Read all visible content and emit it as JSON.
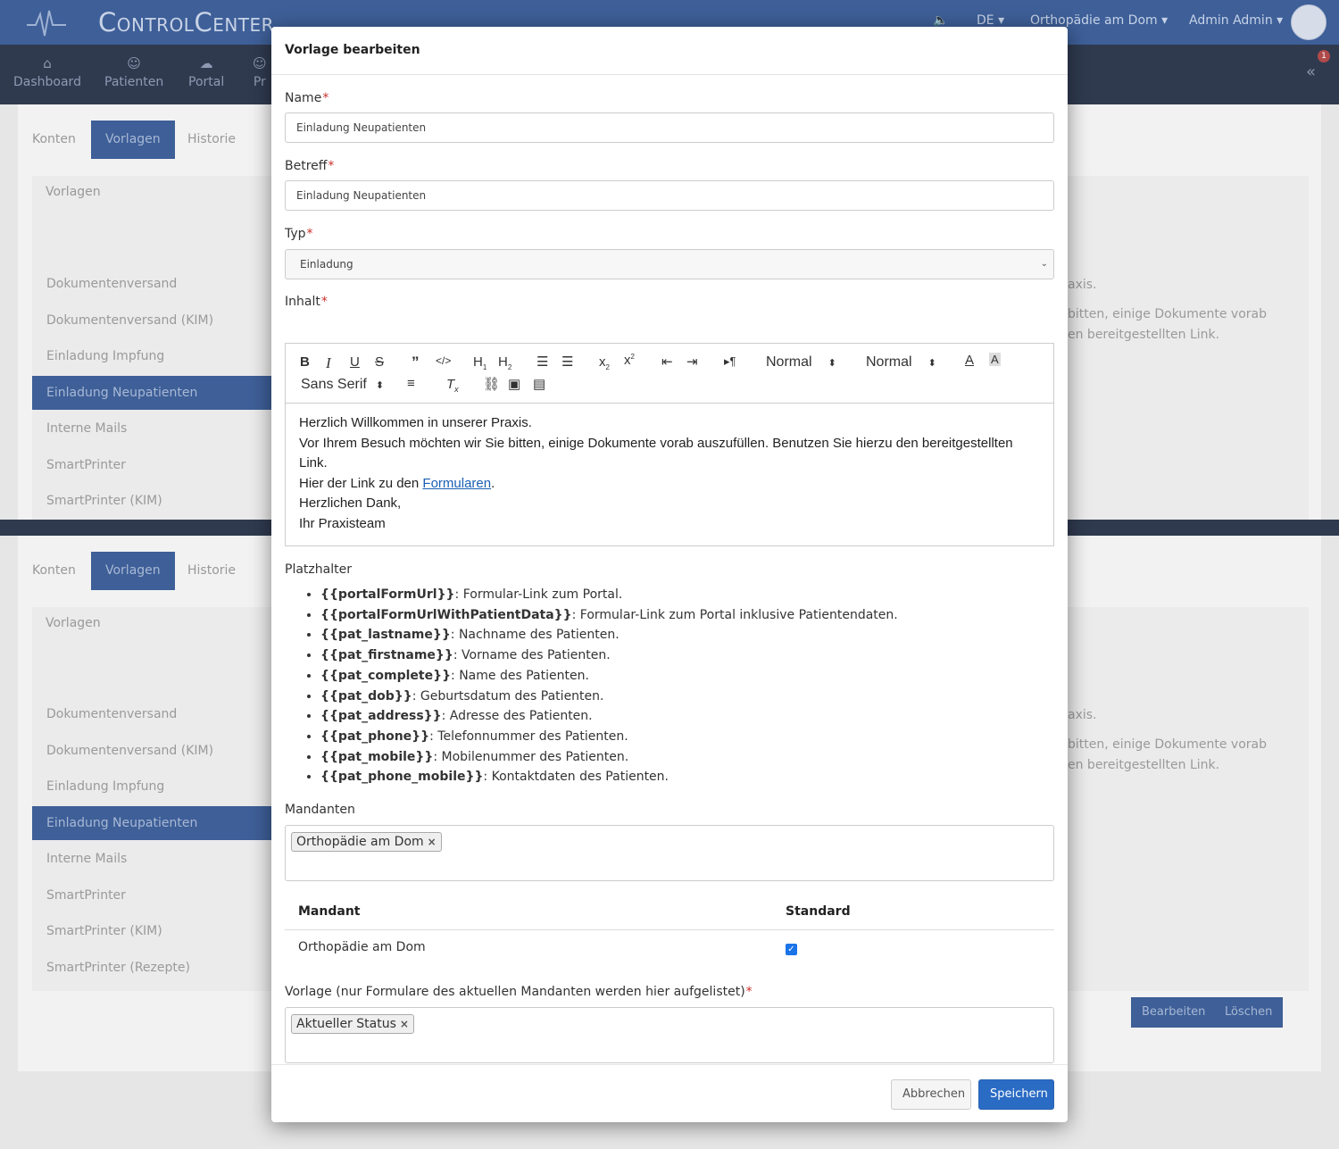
{
  "app": {
    "brand": "ControlCenter",
    "language": "DE",
    "practice": "Orthopädie am Dom",
    "user": "Admin Admin",
    "notification_count": "1",
    "nav": [
      {
        "label": "Dashboard",
        "icon": "home-icon"
      },
      {
        "label": "Patienten",
        "icon": "user-icon"
      },
      {
        "label": "Portal",
        "icon": "cloud-icon"
      },
      {
        "label": "Pr",
        "icon": "user-icon"
      }
    ],
    "collapse_icon": "double-chevron-left-icon"
  },
  "background": {
    "tabs": [
      "Konten",
      "Vorlagen",
      "Historie"
    ],
    "list_title": "Vorlagen",
    "list_items": [
      "Dokumentenversand",
      "Dokumentenversand (KIM)",
      "Einladung Impfung",
      "Einladung Neupatienten",
      "Interne Mails",
      "SmartPrinter",
      "SmartPrinter (KIM)",
      "SmartPrinter (Rezepte)"
    ],
    "preview_text": [
      "axis.",
      "bitten, einige Dokumente vorab",
      "en bereitgestellten Link."
    ],
    "edit_button": "Bearbeiten",
    "delete_button": "Löschen"
  },
  "modal": {
    "title": "Vorlage bearbeiten",
    "name_label": "Name",
    "name_value": "Einladung Neupatienten",
    "subject_label": "Betreff",
    "subject_value": "Einladung Neupatienten",
    "type_label": "Typ",
    "type_value": "Einladung",
    "content_label": "Inhalt",
    "required_mark": "*",
    "toolbar": {
      "header_select": "Normal",
      "size_select": "Normal",
      "font_select": "Sans Serif"
    },
    "content": {
      "line1": "Herzlich Willkommen in unserer Praxis.",
      "line2": "Vor Ihrem Besuch möchten wir Sie bitten, einige Dokumente vorab auszufüllen. Benutzen Sie hierzu den bereitgestellten Link.",
      "line3_prefix": "Hier der Link zu den ",
      "line3_link": "Formularen",
      "line3_suffix": ".",
      "line4": "Herzlichen Dank,",
      "line5": "Ihr Praxisteam"
    },
    "placeholders_title": "Platzhalter",
    "placeholders": [
      {
        "key": "{{portalFormUrl}}",
        "desc": ": Formular-Link zum Portal."
      },
      {
        "key": "{{portalFormUrlWithPatientData}}",
        "desc": ": Formular-Link zum Portal inklusive Patientendaten."
      },
      {
        "key": "{{pat_lastname}}",
        "desc": ": Nachname des Patienten."
      },
      {
        "key": "{{pat_firstname}}",
        "desc": ": Vorname des Patienten."
      },
      {
        "key": "{{pat_complete}}",
        "desc": ": Name des Patienten."
      },
      {
        "key": "{{pat_dob}}",
        "desc": ": Geburtsdatum des Patienten."
      },
      {
        "key": "{{pat_address}}",
        "desc": ": Adresse des Patienten."
      },
      {
        "key": "{{pat_phone}}",
        "desc": ": Telefonnummer des Patienten."
      },
      {
        "key": "{{pat_mobile}}",
        "desc": ": Mobilenummer des Patienten."
      },
      {
        "key": "{{pat_phone_mobile}}",
        "desc": ": Kontaktdaten des Patienten."
      }
    ],
    "clients_label": "Mandanten",
    "clients_tag": "Orthopädie am Dom",
    "tag_remove": "×",
    "table": {
      "col_client": "Mandant",
      "col_default": "Standard",
      "row_client": "Orthopädie am Dom",
      "row_default_checked": true
    },
    "template_label": "Vorlage (nur Formulare des aktuellen Mandanten werden hier aufgelistet)",
    "template_tag": "Aktueller Status",
    "cancel_button": "Abbrechen",
    "save_button": "Speichern"
  }
}
